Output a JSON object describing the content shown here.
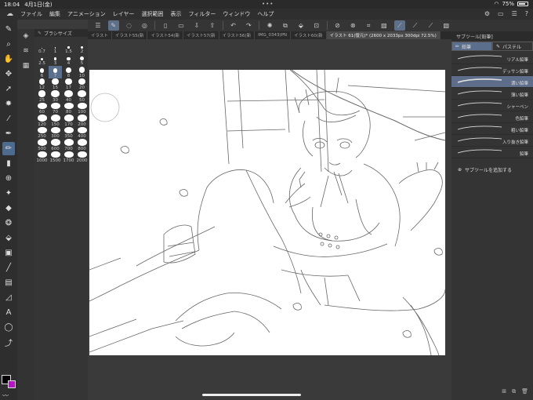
{
  "status_bar": {
    "time": "18:04",
    "date": "4月1日(金)",
    "battery": "75%"
  },
  "menu": {
    "items": [
      "ファイル",
      "編集",
      "アニメーション",
      "レイヤー",
      "選択範囲",
      "表示",
      "フィルター",
      "ウィンドウ",
      "ヘルプ"
    ]
  },
  "brush_panel": {
    "title": "ブラシサイズ",
    "sizes": [
      "0.7",
      "1",
      "1.5",
      "2",
      "2.5",
      "3",
      "4",
      "5",
      "6",
      "7",
      "8",
      "10",
      "12",
      "15",
      "17",
      "20",
      "25",
      "30",
      "40",
      "50",
      "60",
      "70",
      "80",
      "100",
      "120",
      "150",
      "170",
      "200",
      "250",
      "300",
      "350",
      "400",
      "500",
      "600",
      "700",
      "800",
      "1000",
      "1500",
      "1700",
      "2000"
    ],
    "selected": "7"
  },
  "tabs": [
    "イラスト",
    "イラスト55(新",
    "イラスト54(新",
    "イラスト57(新",
    "イラスト56(新",
    "IMG_0343(PN",
    "イラスト60(新",
    "イラスト 61(復元)* (2600 x 2033px 300dpi 72.5%)"
  ],
  "right_panel": {
    "header": "サブツール[鉛筆]",
    "tabs": [
      "鉛筆",
      "パステル"
    ],
    "items": [
      "リアル鉛筆",
      "デッサン鉛筆",
      "濃い鉛筆",
      "薄い鉛筆",
      "シャーペン",
      "色鉛筆",
      "粗い鉛筆",
      "入り抜き鉛筆",
      "鉛筆"
    ],
    "selected": "濃い鉛筆",
    "add_label": "サブツールを追加する"
  },
  "colors": {
    "main": "#000000",
    "sub": "#b516c4",
    "accent": "#5b6f8d"
  }
}
